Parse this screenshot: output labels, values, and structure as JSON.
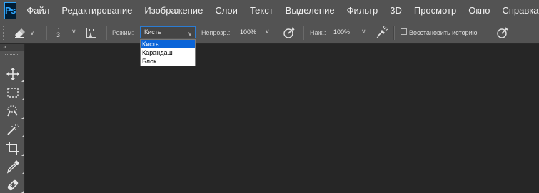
{
  "app": {
    "logo_text": "Ps",
    "accent_color": "#31a8ff"
  },
  "menu": {
    "items": [
      "Файл",
      "Редактирование",
      "Изображение",
      "Слои",
      "Текст",
      "Выделение",
      "Фильтр",
      "3D",
      "Просмотр",
      "Окно",
      "Справка"
    ]
  },
  "options": {
    "brush_size": "3",
    "mode_label": "Режим:",
    "mode_value": "Кисть",
    "opacity_label": "Непрозр.:",
    "opacity_value": "100%",
    "flow_label": "Наж.:",
    "flow_value": "100%",
    "restore_history_label": "Восстановить историю",
    "restore_history_checked": false
  },
  "mode_dropdown": {
    "options": [
      "Кисть",
      "Карандаш",
      "Блок"
    ],
    "selected": "Кисть"
  },
  "toolbar": {
    "collapse_glyph": "»",
    "tools": [
      "move-tool-icon",
      "marquee-tool-icon",
      "lasso-tool-icon",
      "magic-wand-tool-icon",
      "crop-tool-icon",
      "eyedropper-tool-icon",
      "healing-brush-tool-icon"
    ]
  }
}
